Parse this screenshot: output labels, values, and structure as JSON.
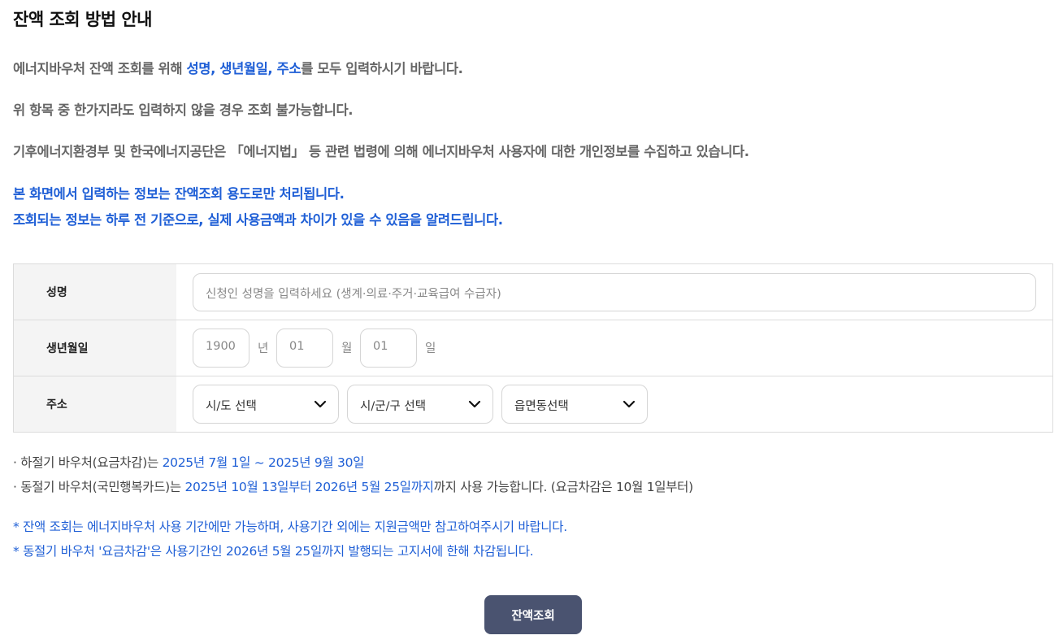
{
  "page_title": "잔액 조회 방법 안내",
  "intro": {
    "line1_pre": "에너지바우처 잔액 조회를 위해 ",
    "line1_highlight": "성명, 생년월일, 주소",
    "line1_post": "를 모두 입력하시기 바랍니다.",
    "line2": "위 항목 중 한가지라도 입력하지 않을 경우 조회 불가능합니다.",
    "line3": "기후에너지환경부 및 한국에너지공단은 「에너지법」 등 관련 법령에 의해 에너지바우처 사용자에 대한 개인정보를 수집하고 있습니다.",
    "line4": "본 화면에서 입력하는 정보는 잔액조회 용도로만 처리됩니다.",
    "line5": "조회되는 정보는 하루 전 기준으로, 실제 사용금액과 차이가 있을 수 있음을 알려드립니다."
  },
  "form": {
    "name_label": "성명",
    "name_placeholder": "신청인 성명을 입력하세요 (생계·의료·주거·교육급여 수급자)",
    "birth_label": "생년월일",
    "year_placeholder": "1900",
    "year_unit": "년",
    "month_placeholder": "01",
    "month_unit": "월",
    "day_placeholder": "01",
    "day_unit": "일",
    "address_label": "주소",
    "sido_select": "시/도 선택",
    "sigungu_select": "시/군/구 선택",
    "eupmyeondong_select": "읍면동선택"
  },
  "notes": {
    "summer_pre": "· 하절기 바우처(요금차감)는 ",
    "summer_period": "2025년 7월 1일 ~ 2025년 9월 30일",
    "winter_pre": "· 동절기 바우처(국민행복카드)는 ",
    "winter_period": "2025년 10월 13일부터 2026년 5월 25일까지",
    "winter_post": "까지 사용 가능합니다. (요금차감은 10월 1일부터)",
    "star1": "* 잔액 조회는 에너지바우처 사용 기간에만 가능하며, 사용기간 외에는 지원금액만 참고하여주시기 바랍니다.",
    "star2": "* 동절기 바우처 '요금차감'은 사용기간인 2026년 5월 25일까지 발행되는 고지서에 한해 차감됩니다."
  },
  "submit_label": "잔액조회",
  "colors": {
    "accent": "#1f5fd6",
    "button": "#4a5370",
    "label_bg": "#f4f4f4"
  }
}
